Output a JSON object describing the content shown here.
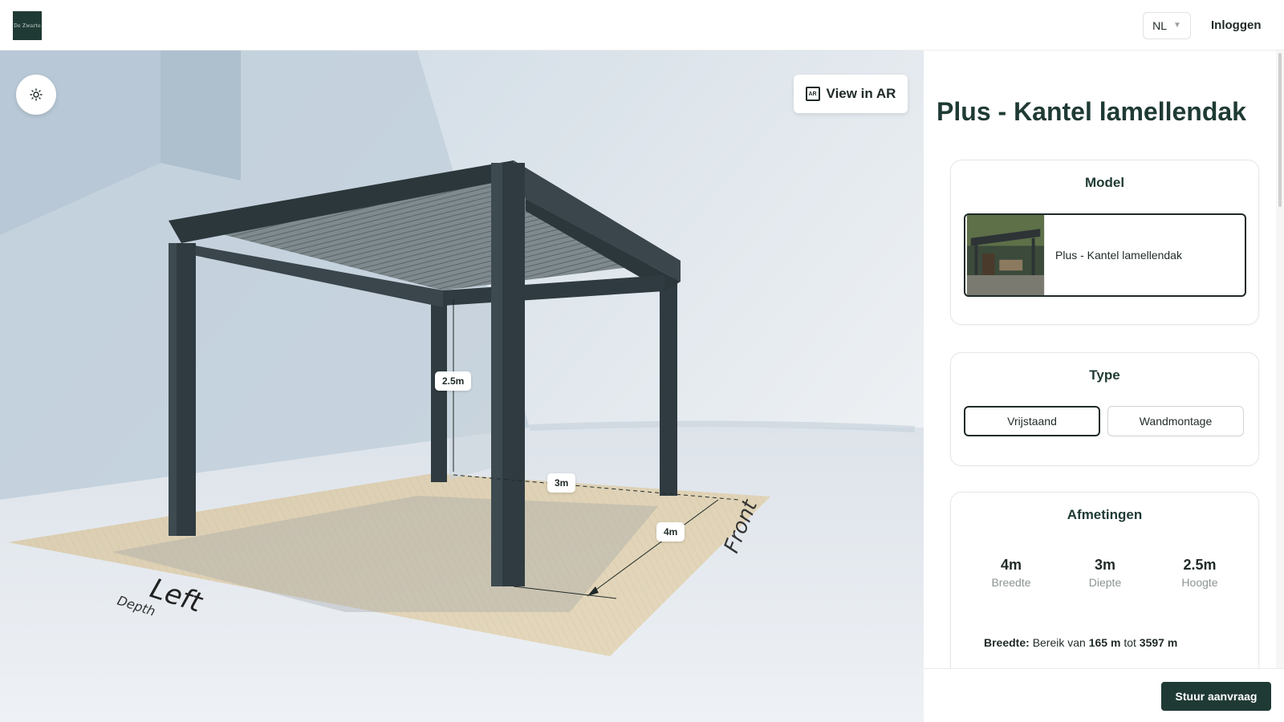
{
  "header": {
    "logo_text": "De Zwarte",
    "language": "NL",
    "login_label": "Inloggen"
  },
  "viewer": {
    "ar_button_label": "View in AR",
    "ar_icon_text": "AR",
    "lighting_icon": "sun-icon",
    "dimension_tags": {
      "height": "2.5m",
      "depth": "3m",
      "width": "4m"
    },
    "floor_labels": {
      "left": "Left",
      "left_sub": "Depth",
      "front": "Front"
    }
  },
  "panel": {
    "title": "Plus - Kantel lamellendak",
    "model": {
      "heading": "Model",
      "selected_label": "Plus - Kantel lamellendak"
    },
    "type": {
      "heading": "Type",
      "options": [
        {
          "label": "Vrijstaand",
          "selected": true
        },
        {
          "label": "Wandmontage",
          "selected": false
        }
      ]
    },
    "dimensions": {
      "heading": "Afmetingen",
      "items": [
        {
          "value": "4m",
          "label": "Breedte"
        },
        {
          "value": "3m",
          "label": "Diepte"
        },
        {
          "value": "2.5m",
          "label": "Hoogte"
        }
      ],
      "range": {
        "label": "Breedte:",
        "text_before": "Bereik van",
        "min": "165 m",
        "text_between": "tot",
        "max": "3597 m"
      }
    },
    "submit_label": "Stuur aanvraag"
  },
  "colors": {
    "brand": "#1f3a34",
    "frame": "#2f3b40",
    "deck": "#d8c8a8"
  }
}
